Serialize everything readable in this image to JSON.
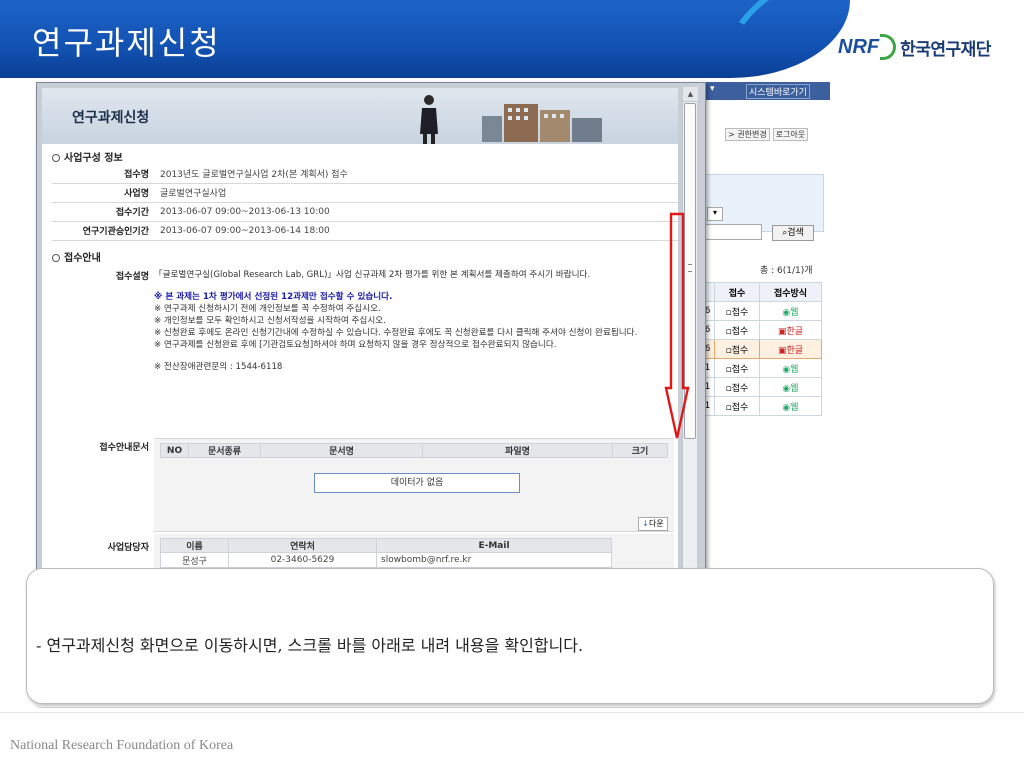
{
  "slide": {
    "title": "연구과제신청",
    "logo_mark": "NRF",
    "logo_name": "한국연구재단",
    "caption": "- 연구과제신청 화면으로 이동하시면, 스크롤 바를 아래로 내려 내용을 확인합니다.",
    "footer": "National Research Foundation of Korea"
  },
  "colors": {
    "header_blue": "#1252b2",
    "arrow_red": "#e01818",
    "logo_green": "#3aa544"
  },
  "background_page": {
    "topbar_menu_1": "▾",
    "topbar_menu_2": "시스템바로가기",
    "links": [
      "> 권한변경",
      "로그아웃"
    ],
    "select_arrow": "▾",
    "search_button": "검색",
    "total_count": "총 : 6(1/1)개",
    "table_headers": [
      "접수",
      "접수방식"
    ],
    "rows": [
      {
        "prefix": "6",
        "status": "접수",
        "method": "웹"
      },
      {
        "prefix": "6",
        "status": "접수",
        "method": "한글"
      },
      {
        "prefix": "6",
        "status": "접수",
        "method": "한글"
      },
      {
        "prefix": "1",
        "status": "접수",
        "method": "웹"
      },
      {
        "prefix": "1",
        "status": "접수",
        "method": "웹"
      },
      {
        "prefix": "1",
        "status": "접수",
        "method": "웹"
      }
    ]
  },
  "popup": {
    "banner_title": "연구과제신청",
    "section_business": "사업구성 정보",
    "fields": [
      {
        "label": "접수명",
        "value": "2013년도 글로벌연구실사업 2차(본 계획서) 접수"
      },
      {
        "label": "사업명",
        "value": "글로벌연구실사업"
      },
      {
        "label": "접수기간",
        "value": "2013-06-07 09:00~2013-06-13 10:00"
      },
      {
        "label": "연구기관승인기간",
        "value": "2013-06-07 09:00~2013-06-14 18:00"
      }
    ],
    "section_guide": "접수안내",
    "guide_label": "접수설명",
    "guide_lines": {
      "intro": "「글로벌연구실(Global Research Lab, GRL)」사업 신규과제 2차 평가를 위한 본 계획서를 제출하여 주시기 바랍니다.",
      "strong": "※ 본 과제는 1차 평가에서 선정된 12과제만 접수할 수 있습니다.",
      "n1": "※ 연구과제 신청하시기 전에 개인정보를 꼭 수정하여 주십시오.",
      "n2": "※ 개인정보를 모두 확인하시고 신청서작성을 시작하여 주십시오.",
      "n3": "※ 신청완료 후에도 온라인 신청기간내에 수정하실 수 있습니다. 수정완료 후에도 꼭 신청완료를 다시 클릭해 주셔야 신청이 완료됩니다.",
      "n4": "※ 연구과제를 신청완료 후에 [기관검토요청]하셔야 하며 요청하지 않을 경우 정상적으로 접수완료되지 않습니다.",
      "helpdesk": "※ 전산장애관련문의 : 1544-6118"
    },
    "docs_label": "접수안내문서",
    "docs_headers": [
      "NO",
      "문서종류",
      "문서명",
      "파일명",
      "크기"
    ],
    "docs_empty": "데이터가 없음",
    "download": "다운",
    "contact_label": "사업담당자",
    "contact_headers": [
      "이름",
      "연락처",
      "E-Mail"
    ],
    "contact": {
      "name": "문성구",
      "phone": "02-3460-5629",
      "email": "slowbomb@nrf.re.kr"
    }
  }
}
